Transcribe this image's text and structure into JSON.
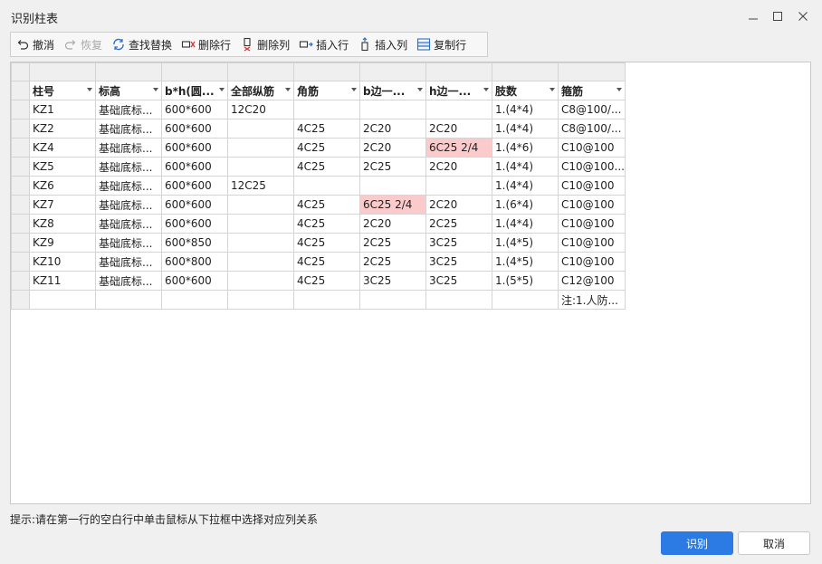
{
  "window": {
    "title": "识别柱表"
  },
  "toolbar": {
    "items": [
      {
        "label": "撤消",
        "icon": "undo-icon",
        "enabled": true
      },
      {
        "label": "恢复",
        "icon": "redo-icon",
        "enabled": false
      },
      {
        "label": "查找替换",
        "icon": "find-replace-icon",
        "enabled": true
      },
      {
        "label": "删除行",
        "icon": "delete-row-icon",
        "enabled": true
      },
      {
        "label": "删除列",
        "icon": "delete-column-icon",
        "enabled": true
      },
      {
        "label": "插入行",
        "icon": "insert-row-icon",
        "enabled": true
      },
      {
        "label": "插入列",
        "icon": "insert-column-icon",
        "enabled": true
      },
      {
        "label": "复制行",
        "icon": "copy-row-icon",
        "enabled": true
      }
    ]
  },
  "table": {
    "columns": [
      "柱号",
      "标高",
      "b*h(圆...",
      "全部纵筋",
      "角筋",
      "b边一...",
      "h边一...",
      "肢数",
      "箍筋"
    ],
    "rows": [
      [
        "KZ1",
        "基础底标...",
        "600*600",
        "12C20",
        "",
        "",
        "",
        "1.(4*4)",
        "C8@100/..."
      ],
      [
        "KZ2",
        "基础底标...",
        "600*600",
        "",
        "4C25",
        "2C20",
        "2C20",
        "1.(4*4)",
        "C8@100/..."
      ],
      [
        "KZ4",
        "基础底标...",
        "600*600",
        "",
        "4C25",
        "2C20",
        "6C25 2/4",
        "1.(4*6)",
        "C10@100"
      ],
      [
        "KZ5",
        "基础底标...",
        "600*600",
        "",
        "4C25",
        "2C25",
        "2C20",
        "1.(4*4)",
        "C10@100..."
      ],
      [
        "KZ6",
        "基础底标...",
        "600*600",
        "12C25",
        "",
        "",
        "",
        "1.(4*4)",
        "C10@100"
      ],
      [
        "KZ7",
        "基础底标...",
        "600*600",
        "",
        "4C25",
        "6C25 2/4",
        "2C20",
        "1.(6*4)",
        "C10@100"
      ],
      [
        "KZ8",
        "基础底标...",
        "600*600",
        "",
        "4C25",
        "2C20",
        "2C25",
        "1.(4*4)",
        "C10@100"
      ],
      [
        "KZ9",
        "基础底标...",
        "600*850",
        "",
        "4C25",
        "2C25",
        "3C25",
        "1.(4*5)",
        "C10@100"
      ],
      [
        "KZ10",
        "基础底标...",
        "600*800",
        "",
        "4C25",
        "2C25",
        "3C25",
        "1.(4*5)",
        "C10@100"
      ],
      [
        "KZ11",
        "基础底标...",
        "600*600",
        "",
        "4C25",
        "3C25",
        "3C25",
        "1.(5*5)",
        "C12@100"
      ],
      [
        "",
        "",
        "",
        "",
        "",
        "",
        "",
        "",
        "注:1.人防..."
      ]
    ],
    "highlighted_cells": [
      {
        "row": 2,
        "col": 6
      },
      {
        "row": 5,
        "col": 5
      }
    ],
    "highlight_color": "#fbcaca"
  },
  "hint": "提示:请在第一行的空白行中单击鼠标从下拉框中选择对应列关系",
  "buttons": {
    "recognize": "识别",
    "cancel": "取消"
  },
  "colors": {
    "primary": "#2c7be5",
    "background": "#f0f0f0"
  }
}
